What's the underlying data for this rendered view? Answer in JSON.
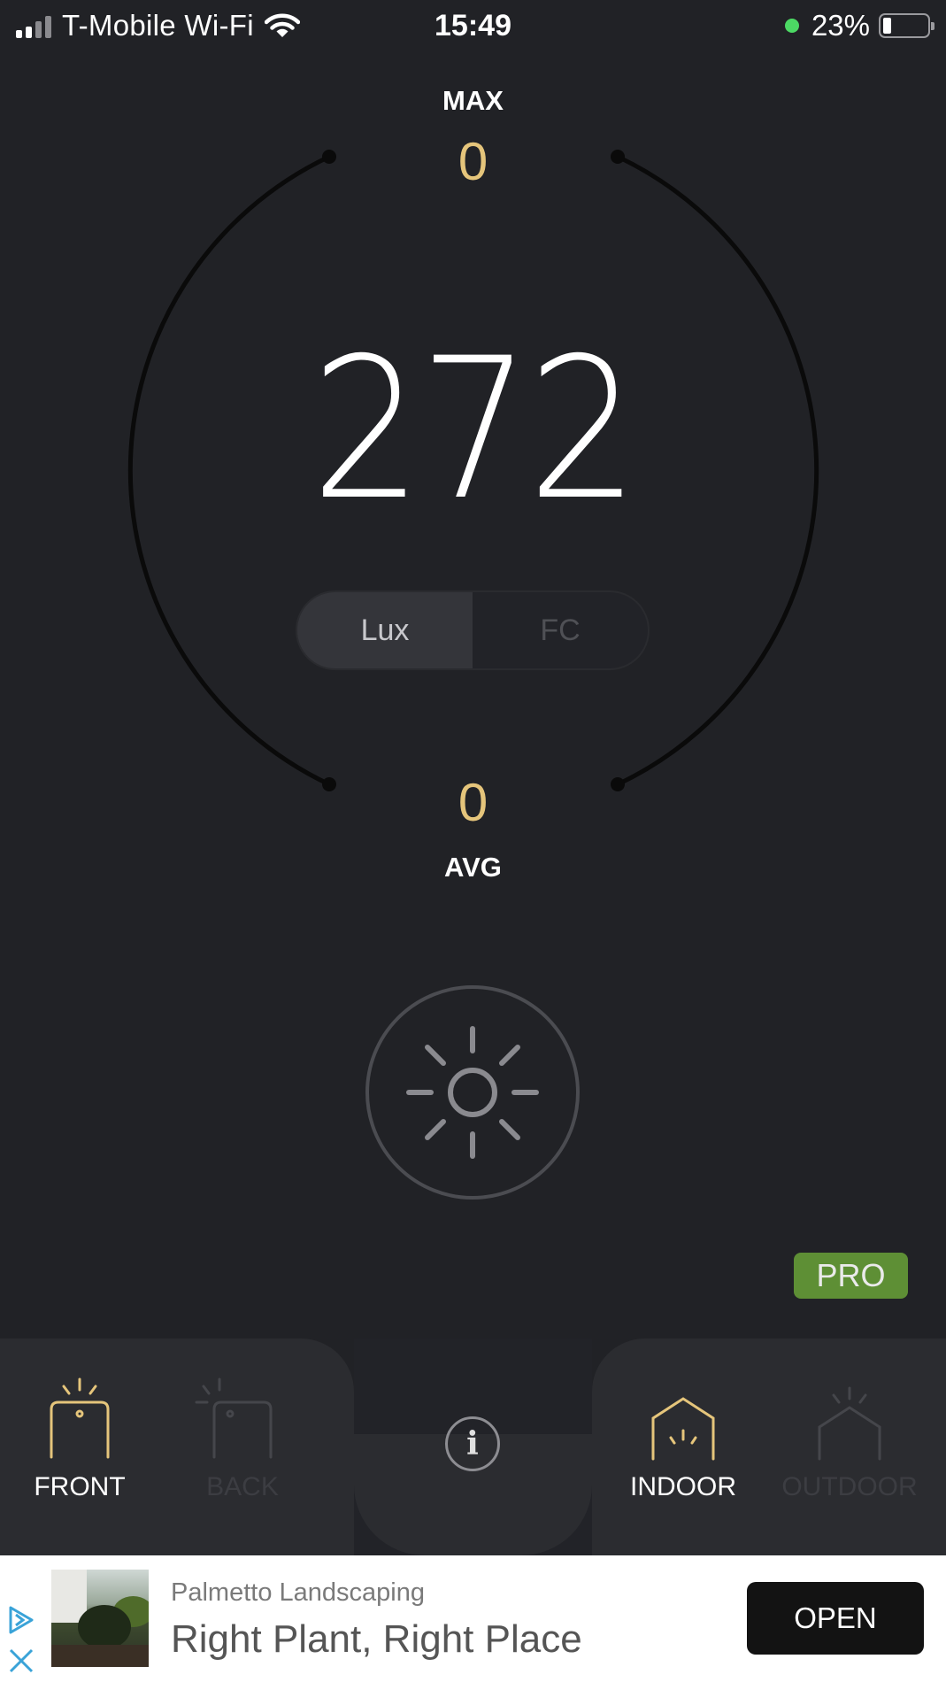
{
  "status_bar": {
    "carrier": "T-Mobile Wi-Fi",
    "time": "15:49",
    "battery": "23%"
  },
  "meter": {
    "max_label": "MAX",
    "max_value": "0",
    "reading": "272",
    "avg_value": "0",
    "avg_label": "AVG",
    "accent_color": "#e5c57b"
  },
  "units": {
    "options": [
      "Lux",
      "FC"
    ],
    "selected": "Lux"
  },
  "pro_badge": "PRO",
  "pro_color": "#5e8f35",
  "camera": {
    "front_label": "FRONT",
    "back_label": "BACK",
    "selected": "FRONT"
  },
  "environment": {
    "indoor_label": "INDOOR",
    "outdoor_label": "OUTDOOR",
    "selected": "INDOOR"
  },
  "ad": {
    "advertiser": "Palmetto Landscaping",
    "headline": "Right Plant, Right Place",
    "cta": "OPEN"
  },
  "icons": [
    "wifi-icon",
    "sun-icon",
    "info-icon",
    "front-camera-icon",
    "back-camera-icon",
    "indoor-icon",
    "outdoor-icon",
    "adchoices-icon",
    "close-icon"
  ]
}
